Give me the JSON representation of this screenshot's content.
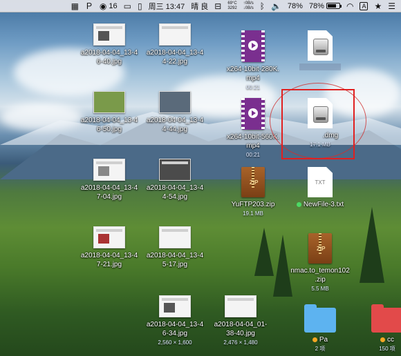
{
  "menubar": {
    "wechat_badge": "16",
    "clock": "周三 13:47",
    "weather": "晴 良",
    "temperature": "69°C",
    "fan_rpm": "3292",
    "net_up": "0B/s",
    "net_down": "0B/s",
    "battery_left": "78%",
    "battery_right": "78%",
    "battery_fraction": 0.78,
    "input_source": "A"
  },
  "icons": [
    {
      "name": "a2018-04-04_13-46-40.jpg",
      "line1": "a2018-04-04_13-4",
      "line2": "6-40.jpg"
    },
    {
      "name": "a2018-04-04_13-44-22.jpg",
      "line1": "a2018-04-04_13-4",
      "line2": "4-22.jpg"
    },
    {
      "name": "a2018-04-04_13-46-50.jpg",
      "line1": "a2018-04-04_13-4",
      "line2": "6-50.jpg"
    },
    {
      "name": "a2018-04-04_13-44-44.jpg",
      "line1": "a2018-04-04_13-4",
      "line2": "4-44.jpg"
    },
    {
      "name": "a2018-04-04_13-47-04.jpg",
      "line1": "a2018-04-04_13-4",
      "line2": "7-04.jpg"
    },
    {
      "name": "a2018-04-04_13-44-54.jpg",
      "line1": "a2018-04-04_13-4",
      "line2": "4-54.jpg"
    },
    {
      "name": "a2018-04-04_13-47-21.jpg",
      "line1": "a2018-04-04_13-4",
      "line2": "7-21.jpg"
    },
    {
      "name": "a2018-04-04_13-45-17.jpg",
      "line1": "a2018-04-04_13-4",
      "line2": "5-17.jpg"
    },
    {
      "name": "a2018-04-04_13-46-34.jpg",
      "line1": "a2018-04-04_13-4",
      "line2": "6-34.jpg",
      "meta": "2,560 × 1,600"
    },
    {
      "name": "a2018-04-04_01-38-40.jpg",
      "line1": "a2018-04-04_01-",
      "line2": "38-40.jpg",
      "meta": "2,476 × 1,480"
    },
    {
      "name": "x264-10bit-280K.mp4",
      "line1": "x264-10bit-280K.",
      "line2": "mp4",
      "meta": "00:21"
    },
    {
      "name": "x264-10bit-560K.mp4",
      "line1": "x264-10bit-560K.",
      "line2": "mp4",
      "meta": "00:21"
    },
    {
      "name": "YuFTP203.zip",
      "line1": "YuFTP203.zip",
      "meta": "19.1 MB"
    },
    {
      "name": "nmac.to_temon102.zip",
      "line1": "nmac.to_temon102",
      ".line2": "",
      "line2": ".zip",
      "meta": "5.5 MB"
    },
    {
      "name": "dmg-top",
      "line1": ""
    },
    {
      "name": ".dmg",
      "line1": ".dmg",
      "meta": "17.1 MB"
    },
    {
      "name": "NewFile-3.txt",
      "line1": "NewFile-3.txt",
      "tag_color": "#4cd964",
      "doc_label": "TXT"
    },
    {
      "name": "Pa",
      "line1": "Pa",
      "meta": "2 项",
      "tag_color": "#f5a623"
    },
    {
      "name": "cc",
      "line1": "cc",
      "meta": "150 项",
      "tag_color": "#f5a623"
    }
  ]
}
